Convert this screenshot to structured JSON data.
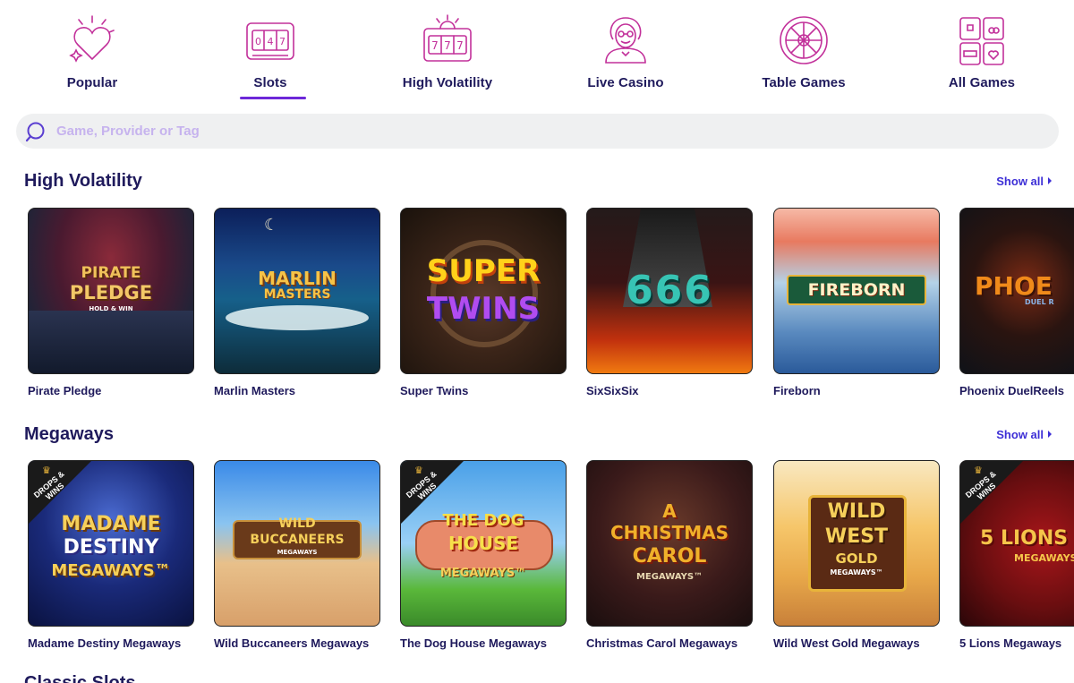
{
  "categories": [
    {
      "label": "Popular",
      "icon": "heart-sparkle-icon",
      "active": false
    },
    {
      "label": "Slots",
      "icon": "slot-machine-icon",
      "active": true
    },
    {
      "label": "High Volatility",
      "icon": "jackpot-777-icon",
      "active": false
    },
    {
      "label": "Live Casino",
      "icon": "live-dealer-icon",
      "active": false
    },
    {
      "label": "Table Games",
      "icon": "roulette-wheel-icon",
      "active": false
    },
    {
      "label": "All Games",
      "icon": "game-cards-icon",
      "active": false
    }
  ],
  "search": {
    "placeholder": "Game, Provider or Tag",
    "value": ""
  },
  "sections": [
    {
      "title": "High Volatility",
      "show_all": "Show all",
      "games": [
        {
          "name": "Pirate Pledge",
          "logo": [
            "PIRATE",
            "PLEDGE",
            "HOLD & WIN"
          ]
        },
        {
          "name": "Marlin Masters",
          "logo": [
            "MARLIN",
            "MASTERS"
          ]
        },
        {
          "name": "Super Twins",
          "logo": [
            "SUPER",
            "TWINS"
          ]
        },
        {
          "name": "SixSixSix",
          "logo": [
            "666"
          ]
        },
        {
          "name": "Fireborn",
          "logo": [
            "FIREBORN"
          ]
        },
        {
          "name": "Phoenix DuelReels",
          "logo": [
            "PHOE",
            "DUEL R"
          ]
        }
      ]
    },
    {
      "title": "Megaways",
      "show_all": "Show all",
      "badge": "DROPS & WINS",
      "games": [
        {
          "name": "Madame Destiny Megaways",
          "logo": [
            "MADAME",
            "DESTINY",
            "MEGAWAYS™"
          ],
          "badge": true
        },
        {
          "name": "Wild Buccaneers Megaways",
          "logo": [
            "WILD",
            "BUCCANEERS",
            "MEGAWAYS"
          ],
          "badge": false
        },
        {
          "name": "The Dog House Megaways",
          "logo": [
            "THE DOG",
            "HOUSE",
            "MEGAWAYS™"
          ],
          "badge": true
        },
        {
          "name": "Christmas Carol Megaways",
          "logo": [
            "A",
            "CHRISTMAS",
            "CAROL",
            "MEGAWAYS™"
          ],
          "badge": false
        },
        {
          "name": "Wild West Gold Megaways",
          "logo": [
            "WILD",
            "WEST",
            "GOLD",
            "MEGAWAYS™"
          ],
          "badge": false
        },
        {
          "name": "5 Lions Megaways",
          "logo": [
            "5 LIONS",
            "MEGAWAYS"
          ],
          "badge": true
        }
      ]
    }
  ],
  "next_section_peek": "Classic Slots",
  "colors": {
    "nav_text": "#1f1a5c",
    "accent": "#6d28d9",
    "link": "#3d2fd6",
    "icon": "#c2309a",
    "search_bg": "#eff0f1"
  }
}
